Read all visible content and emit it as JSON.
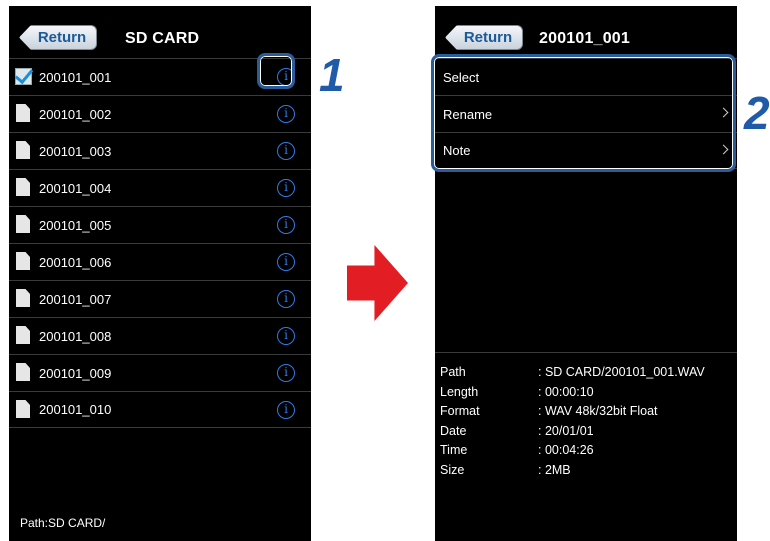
{
  "left_screen": {
    "return_label": "Return",
    "title": "SD CARD",
    "files": [
      {
        "name": "200101_001",
        "selected": true
      },
      {
        "name": "200101_002",
        "selected": false
      },
      {
        "name": "200101_003",
        "selected": false
      },
      {
        "name": "200101_004",
        "selected": false
      },
      {
        "name": "200101_005",
        "selected": false
      },
      {
        "name": "200101_006",
        "selected": false
      },
      {
        "name": "200101_007",
        "selected": false
      },
      {
        "name": "200101_008",
        "selected": false
      },
      {
        "name": "200101_009",
        "selected": false
      },
      {
        "name": "200101_010",
        "selected": false
      }
    ],
    "info_glyph": "i",
    "path": "Path:SD CARD/"
  },
  "right_screen": {
    "return_label": "Return",
    "title": "200101_001",
    "menu": [
      {
        "label": "Select",
        "chevron": false
      },
      {
        "label": "Rename",
        "chevron": true
      },
      {
        "label": "Note",
        "chevron": true
      }
    ],
    "details": [
      {
        "key": "Path",
        "value": ": SD CARD/200101_001.WAV"
      },
      {
        "key": "Length",
        "value": ": 00:00:10"
      },
      {
        "key": "Format",
        "value": ": WAV 48k/32bit Float"
      },
      {
        "key": "Date",
        "value": ": 20/01/01"
      },
      {
        "key": "Time",
        "value": ": 00:04:26"
      },
      {
        "key": "Size",
        "value": ": 2MB"
      }
    ]
  },
  "callouts": {
    "step_1": "1",
    "step_2": "2"
  },
  "colors": {
    "accent_blue": "#2f7be8",
    "callout_blue": "#1f5ba8",
    "arrow_red": "#e31d24",
    "screen_bg": "#000000"
  }
}
